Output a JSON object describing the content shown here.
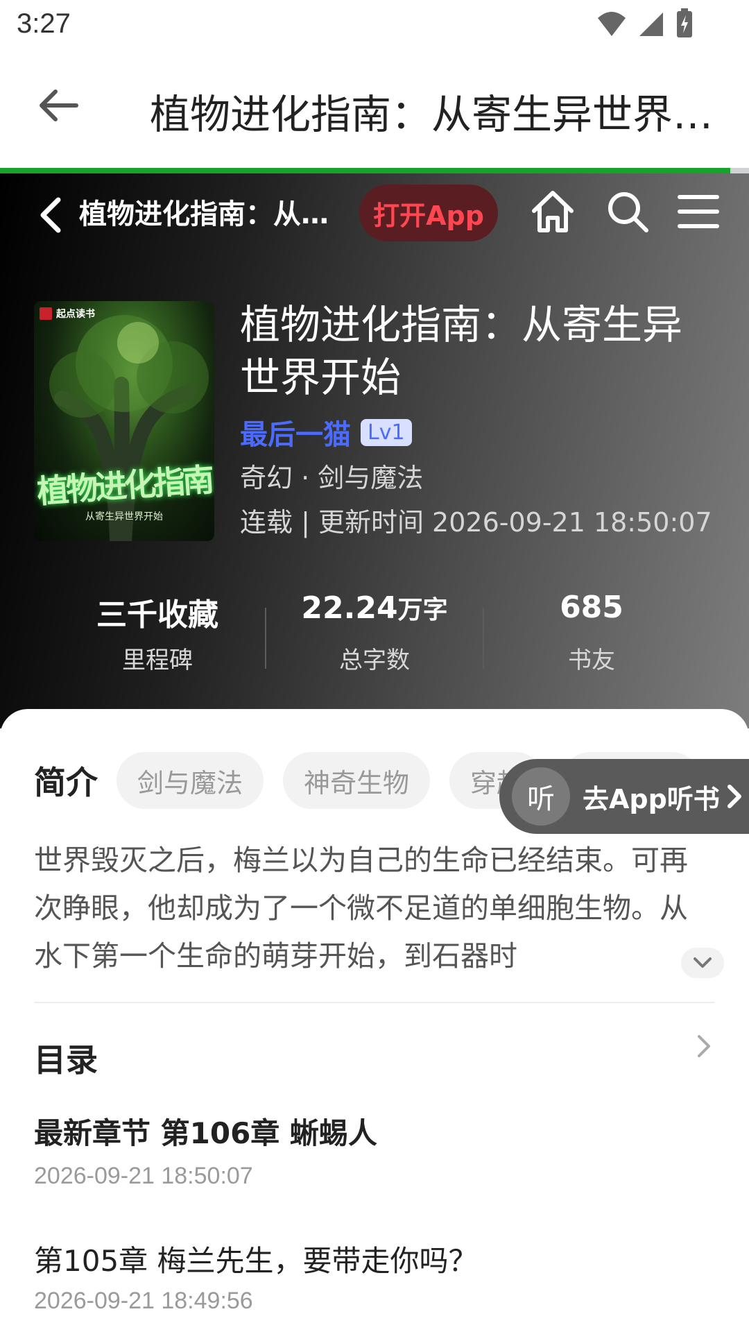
{
  "status_bar": {
    "time": "3:27"
  },
  "app_bar": {
    "title": "植物进化指南：从寄生异世界开始"
  },
  "progress": {
    "fraction": 0.975
  },
  "hero": {
    "nav_title": "植物进化指南：从寄生异世界开始",
    "open_app": "打开App",
    "cover": {
      "badge": "起点读书",
      "title": "植物进化指南",
      "subtitle": "从寄生异世界开始"
    },
    "book_title": "植物进化指南：从寄生异世界开始",
    "author": "最后一猫",
    "level": "Lv1",
    "genre": "奇幻 · 剑与魔法",
    "update": "连载 | 更新时间 2026-09-21 18:50:07",
    "stats": [
      {
        "value": "三千收藏",
        "unit": "",
        "label": "里程碑"
      },
      {
        "value": "22.24",
        "unit": "万字",
        "label": "总字数"
      },
      {
        "value": "685",
        "unit": "",
        "label": "书友"
      }
    ]
  },
  "intro": {
    "heading": "简介",
    "tags": [
      "剑与魔法",
      "神奇生物",
      "穿越"
    ],
    "listen_icon": "听",
    "listen_label": "去App听书",
    "description": "世界毁灭之后，梅兰以为自己的生命已经结束。可再次睁眼，他却成为了一个微不足道的单细胞生物。从水下第一个生命的萌芽开始，到石器时"
  },
  "toc": {
    "heading": "目录",
    "chapters": [
      {
        "title": "最新章节 第106章 蜥蜴人",
        "date": "2026-09-21 18:50:07"
      },
      {
        "title": "第105章 梅兰先生，要带走你吗？",
        "date": "2026-09-21 18:49:56"
      }
    ]
  },
  "colors": {
    "accent_green": "#16a32d",
    "open_app_red": "#ff4752",
    "author_blue": "#4b6bff"
  }
}
